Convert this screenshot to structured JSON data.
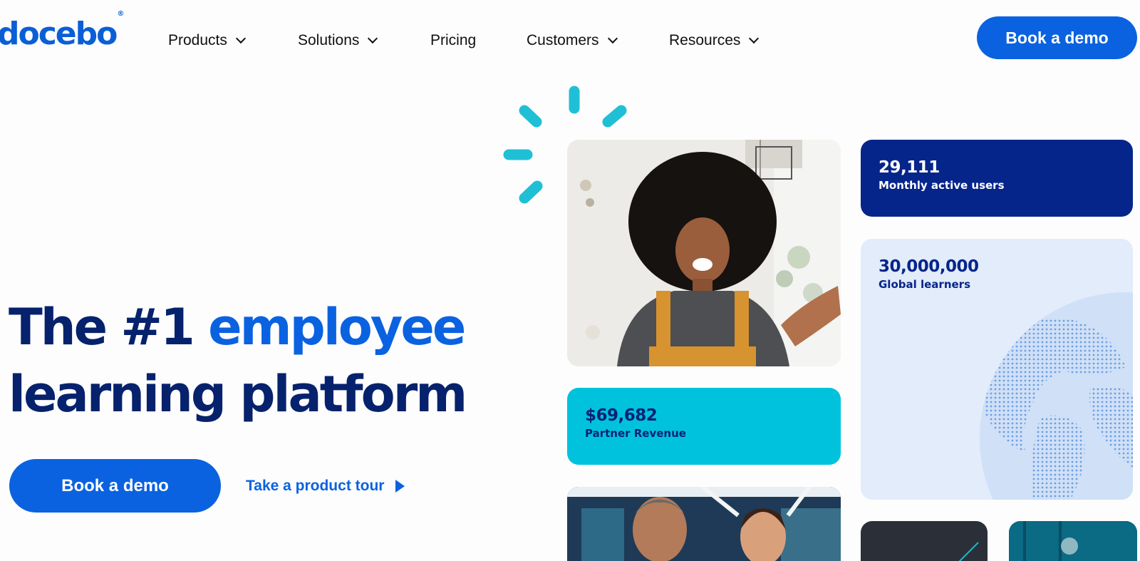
{
  "brand": {
    "logo_text": "docebo",
    "logo_mark": "®"
  },
  "nav": {
    "products": "Products",
    "solutions": "Solutions",
    "pricing": "Pricing",
    "customers": "Customers",
    "resources": "Resources"
  },
  "header": {
    "cta": "Book a demo"
  },
  "hero": {
    "headline_part1": "The #1 ",
    "headline_accent": "employee",
    "headline_line2": "learning platform",
    "cta": "Book a demo",
    "tour_link": "Take a product tour"
  },
  "stats": {
    "users": {
      "value": "29,111",
      "label": "Monthly active users"
    },
    "learners": {
      "value": "30,000,000",
      "label": "Global learners"
    },
    "revenue": {
      "value": "$69,682",
      "label": "Partner Revenue"
    }
  },
  "colors": {
    "brand_blue": "#0a62e0",
    "navy": "#06258a",
    "cyan": "#00c2dd",
    "light_blue": "#e2ecfb"
  }
}
